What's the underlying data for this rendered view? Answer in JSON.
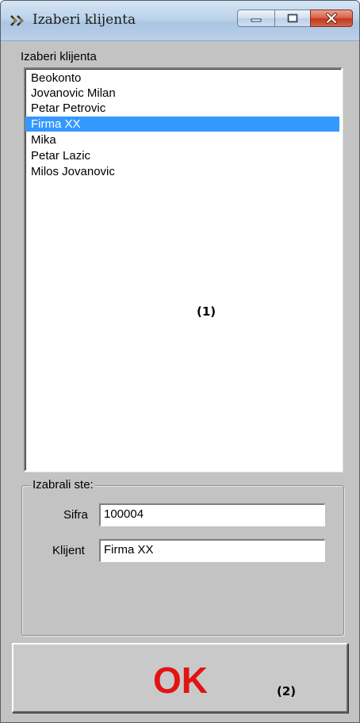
{
  "window": {
    "title": "Izaberi klijenta"
  },
  "client_list": {
    "label": "Izaberi klijenta",
    "items": [
      {
        "label": "Beokonto",
        "selected": false
      },
      {
        "label": "Jovanovic Milan",
        "selected": false
      },
      {
        "label": "Petar Petrovic",
        "selected": false
      },
      {
        "label": "Firma XX",
        "selected": true
      },
      {
        "label": "Mika",
        "selected": false
      },
      {
        "label": "Petar Lazic",
        "selected": false
      },
      {
        "label": "Milos Jovanovic",
        "selected": false
      }
    ],
    "annotation": "(1)"
  },
  "selection_group": {
    "legend": "Izabrali ste:",
    "sifra_label": "Sifra",
    "sifra_value": "100004",
    "klijent_label": "Klijent",
    "klijent_value": "Firma XX"
  },
  "ok_button": {
    "label": "OK",
    "annotation": "(2)"
  },
  "colors": {
    "selection": "#3399ff",
    "ok_text": "#e11414",
    "dialog_background": "#c3c3c3"
  }
}
